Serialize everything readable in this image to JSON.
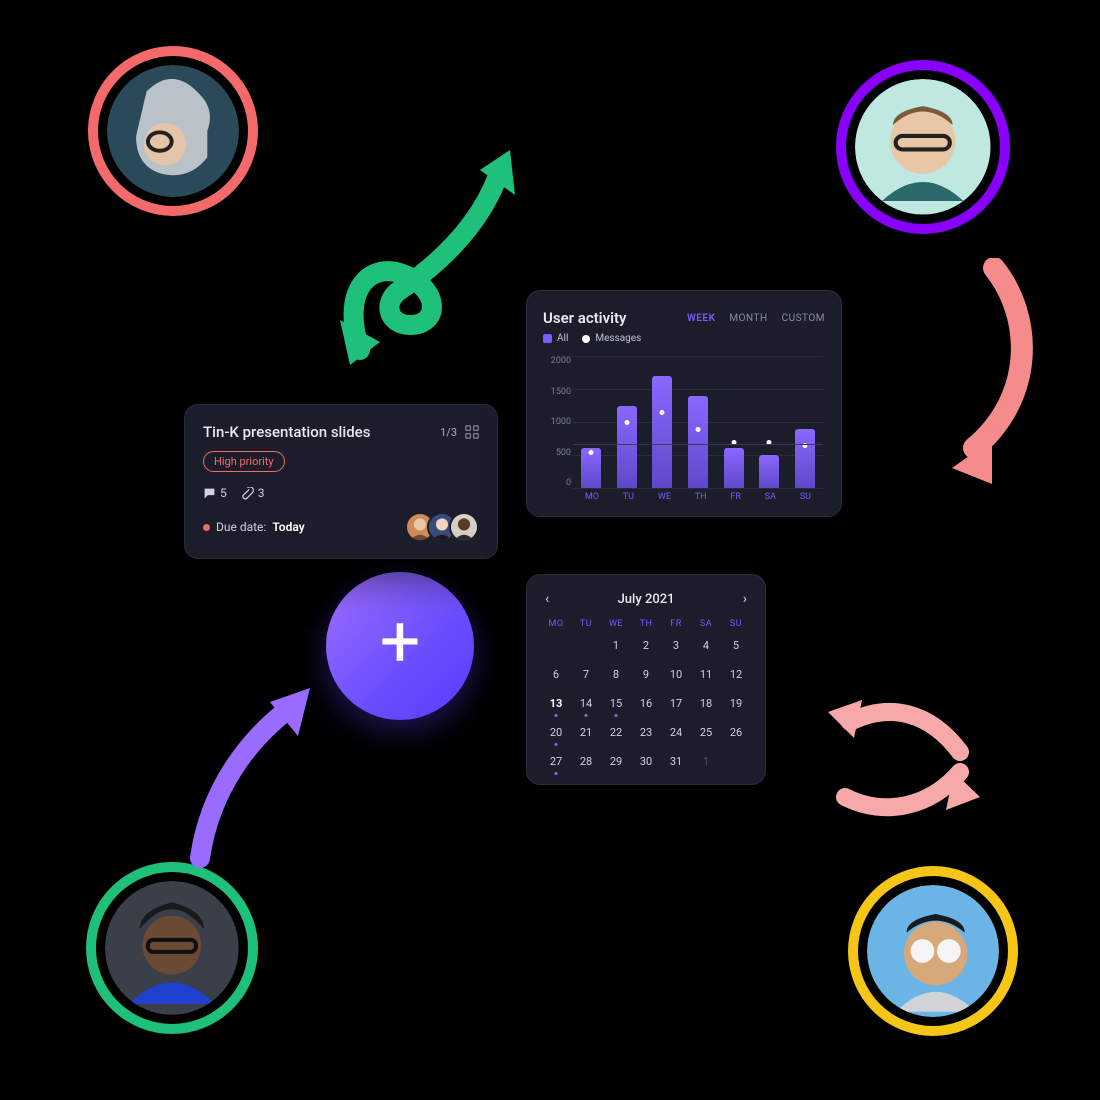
{
  "avatars": {
    "tl": {
      "ring": "#f46a6a"
    },
    "tr": {
      "ring": "#8a00ff"
    },
    "bl": {
      "ring": "#1fc07a"
    },
    "br": {
      "ring": "#f5c518"
    }
  },
  "task": {
    "title": "Tin-K presentation slides",
    "progress": "1/3",
    "priority_label": "High priority",
    "comments": "5",
    "attachments": "3",
    "due_label": "Due date:",
    "due_value": "Today"
  },
  "chart": {
    "title": "User activity",
    "tabs": [
      "WEEK",
      "MONTH",
      "CUSTOM"
    ],
    "active_tab": "WEEK",
    "legend_all": "All",
    "legend_messages": "Messages",
    "ylabels": [
      "2000",
      "1500",
      "1000",
      "500",
      "0"
    ]
  },
  "chart_data": {
    "type": "bar",
    "title": "User activity",
    "xlabel": "",
    "ylabel": "",
    "ylim": [
      0,
      2000
    ],
    "categories": [
      "MO",
      "TU",
      "WE",
      "TH",
      "FR",
      "SA",
      "SU"
    ],
    "series": [
      {
        "name": "All",
        "values": [
          600,
          1250,
          1700,
          1400,
          600,
          500,
          900
        ]
      },
      {
        "name": "Messages",
        "values": [
          500,
          950,
          1100,
          850,
          650,
          650,
          600
        ]
      }
    ]
  },
  "calendar": {
    "title": "July 2021",
    "dow": [
      "MO",
      "TU",
      "WE",
      "TH",
      "FR",
      "SA",
      "SU"
    ],
    "lead_blanks": 2,
    "days": 31,
    "bold_day": 13,
    "dotted_days": [
      13,
      14,
      15,
      20,
      27
    ],
    "trailing": [
      1
    ]
  }
}
